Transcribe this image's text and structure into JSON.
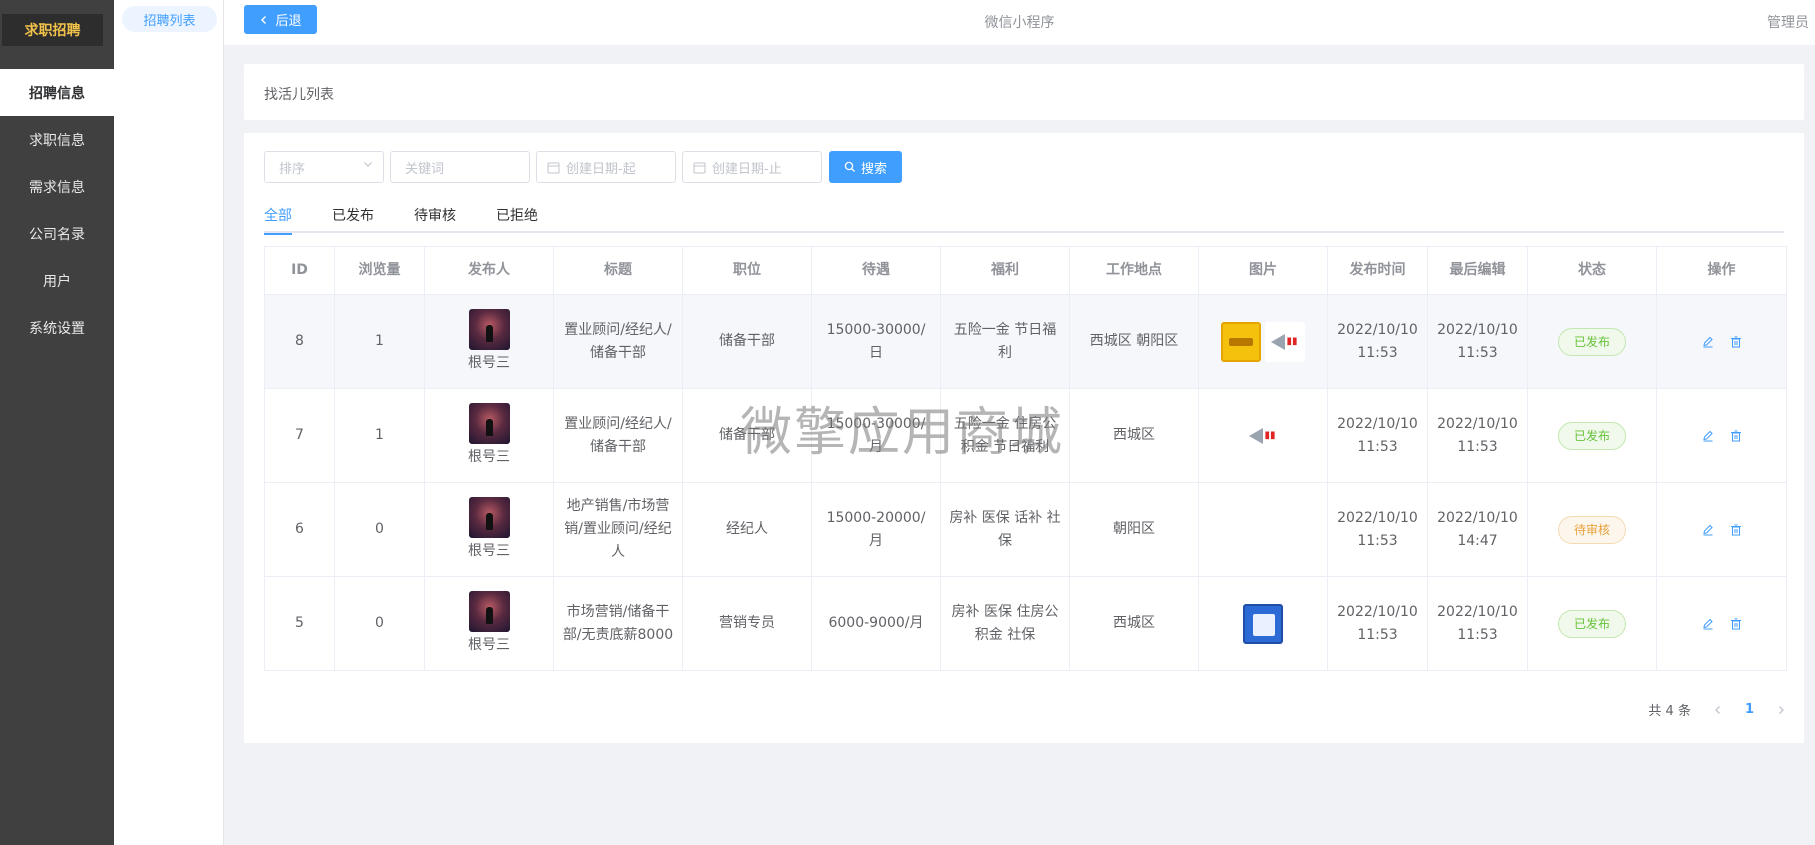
{
  "app": {
    "name": "求职招聘"
  },
  "sidebar": {
    "items": [
      {
        "label": "招聘信息",
        "active": true
      },
      {
        "label": "求职信息",
        "active": false
      },
      {
        "label": "需求信息",
        "active": false
      },
      {
        "label": "公司名录",
        "active": false
      },
      {
        "label": "用户",
        "active": false
      },
      {
        "label": "系统设置",
        "active": false
      }
    ]
  },
  "subnav": {
    "item": "招聘列表"
  },
  "topbar": {
    "back_label": "后退",
    "title": "微信小程序",
    "user": "管理员"
  },
  "section": {
    "title": "找活儿列表"
  },
  "filters": {
    "sort_placeholder": "排序",
    "keyword_placeholder": "关键词",
    "date_start_placeholder": "创建日期-起",
    "date_end_placeholder": "创建日期-止",
    "search_label": "搜索"
  },
  "tabs": [
    "全部",
    "已发布",
    "待审核",
    "已拒绝"
  ],
  "table": {
    "headers": [
      "ID",
      "浏览量",
      "发布人",
      "标题",
      "职位",
      "待遇",
      "福利",
      "工作地点",
      "图片",
      "发布时间",
      "最后编辑",
      "状态",
      "操作"
    ],
    "rows": [
      {
        "id": "8",
        "views": "1",
        "publisher": "根号三",
        "title": "置业顾问/经纪人/储备干部",
        "position": "储备干部",
        "pay": "15000-30000/日",
        "benefits": "五险一金 节日福利",
        "location": "西城区 朝阳区",
        "published": "2022/10/10 11:53",
        "edited": "2022/10/10 11:53",
        "status": "已发布"
      },
      {
        "id": "7",
        "views": "1",
        "publisher": "根号三",
        "title": "置业顾问/经纪人/储备干部",
        "position": "储备干部",
        "pay": "15000-30000/月",
        "benefits": "五险一金 住房公积金 节日福利",
        "location": "西城区",
        "published": "2022/10/10 11:53",
        "edited": "2022/10/10 11:53",
        "status": "已发布"
      },
      {
        "id": "6",
        "views": "0",
        "publisher": "根号三",
        "title": "地产销售/市场营销/置业顾问/经纪人",
        "position": "经纪人",
        "pay": "15000-20000/月",
        "benefits": "房补 医保 话补 社保",
        "location": "朝阳区",
        "published": "2022/10/10 11:53",
        "edited": "2022/10/10 14:47",
        "status": "待审核"
      },
      {
        "id": "5",
        "views": "0",
        "publisher": "根号三",
        "title": "市场营销/储备干部/无责底薪8000",
        "position": "营销专员",
        "pay": "6000-9000/月",
        "benefits": "房补 医保 住房公积金 社保",
        "location": "西城区",
        "published": "2022/10/10 11:53",
        "edited": "2022/10/10 11:53",
        "status": "已发布"
      }
    ]
  },
  "pager": {
    "total": "共 4 条",
    "page": "1"
  },
  "watermark": "微擎应用商城",
  "colors": {
    "accent": "#409eff",
    "sidebar_bg": "#404040",
    "brand_yellow": "#f0c14b",
    "published": "#67c23a",
    "pending": "#e6a23c"
  }
}
